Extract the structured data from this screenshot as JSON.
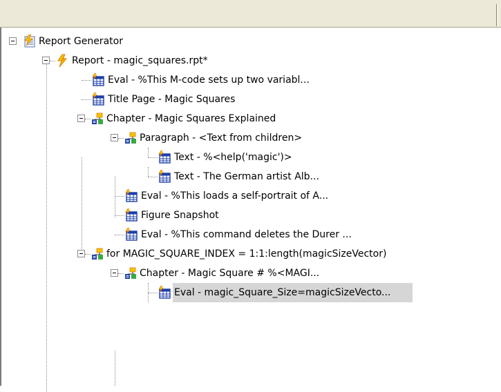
{
  "tree": {
    "nodes": [
      {
        "label": "Report Generator",
        "icon": "report-generator-icon",
        "toggle": "minus"
      },
      {
        "label": "Report - magic_squares.rpt*",
        "icon": "lightning-icon",
        "toggle": "minus"
      },
      {
        "label": "Eval - %This M-code sets up two variabl...",
        "icon": "table-grid-icon"
      },
      {
        "label": "Title Page - Magic Squares",
        "icon": "table-grid-icon"
      },
      {
        "label": "Chapter - Magic Squares Explained",
        "icon": "chapter-hierarchy-icon",
        "toggle": "minus"
      },
      {
        "label": "Paragraph - <Text from children>",
        "icon": "chapter-hierarchy-icon",
        "toggle": "minus"
      },
      {
        "label": "Text - %<help('magic')>",
        "icon": "table-grid-icon"
      },
      {
        "label": "Text - The German artist Alb...",
        "icon": "table-grid-icon"
      },
      {
        "label": "Eval - %This loads a self-portrait of A...",
        "icon": "table-grid-icon"
      },
      {
        "label": "Figure Snapshot",
        "icon": "table-grid-icon"
      },
      {
        "label": "Eval - %This command deletes the Durer ...",
        "icon": "table-grid-icon"
      },
      {
        "label": "for MAGIC_SQUARE_INDEX = 1:1:length(magicSizeVector)",
        "icon": "chapter-hierarchy-icon",
        "toggle": "minus"
      },
      {
        "label": "Chapter - Magic Square # %<MAGI...",
        "icon": "chapter-hierarchy-icon",
        "toggle": "minus"
      },
      {
        "label": "Eval - magic_Square_Size=magicSizeVecto...",
        "icon": "table-grid-icon",
        "selected": true
      }
    ]
  },
  "colors": {
    "header_bg": "#ece9d8",
    "selection": "#d6d6d6",
    "grid_icon_blue": "#1c3fa8",
    "lightning_yellow": "#f2c500",
    "lightning_orange": "#e07a10"
  }
}
